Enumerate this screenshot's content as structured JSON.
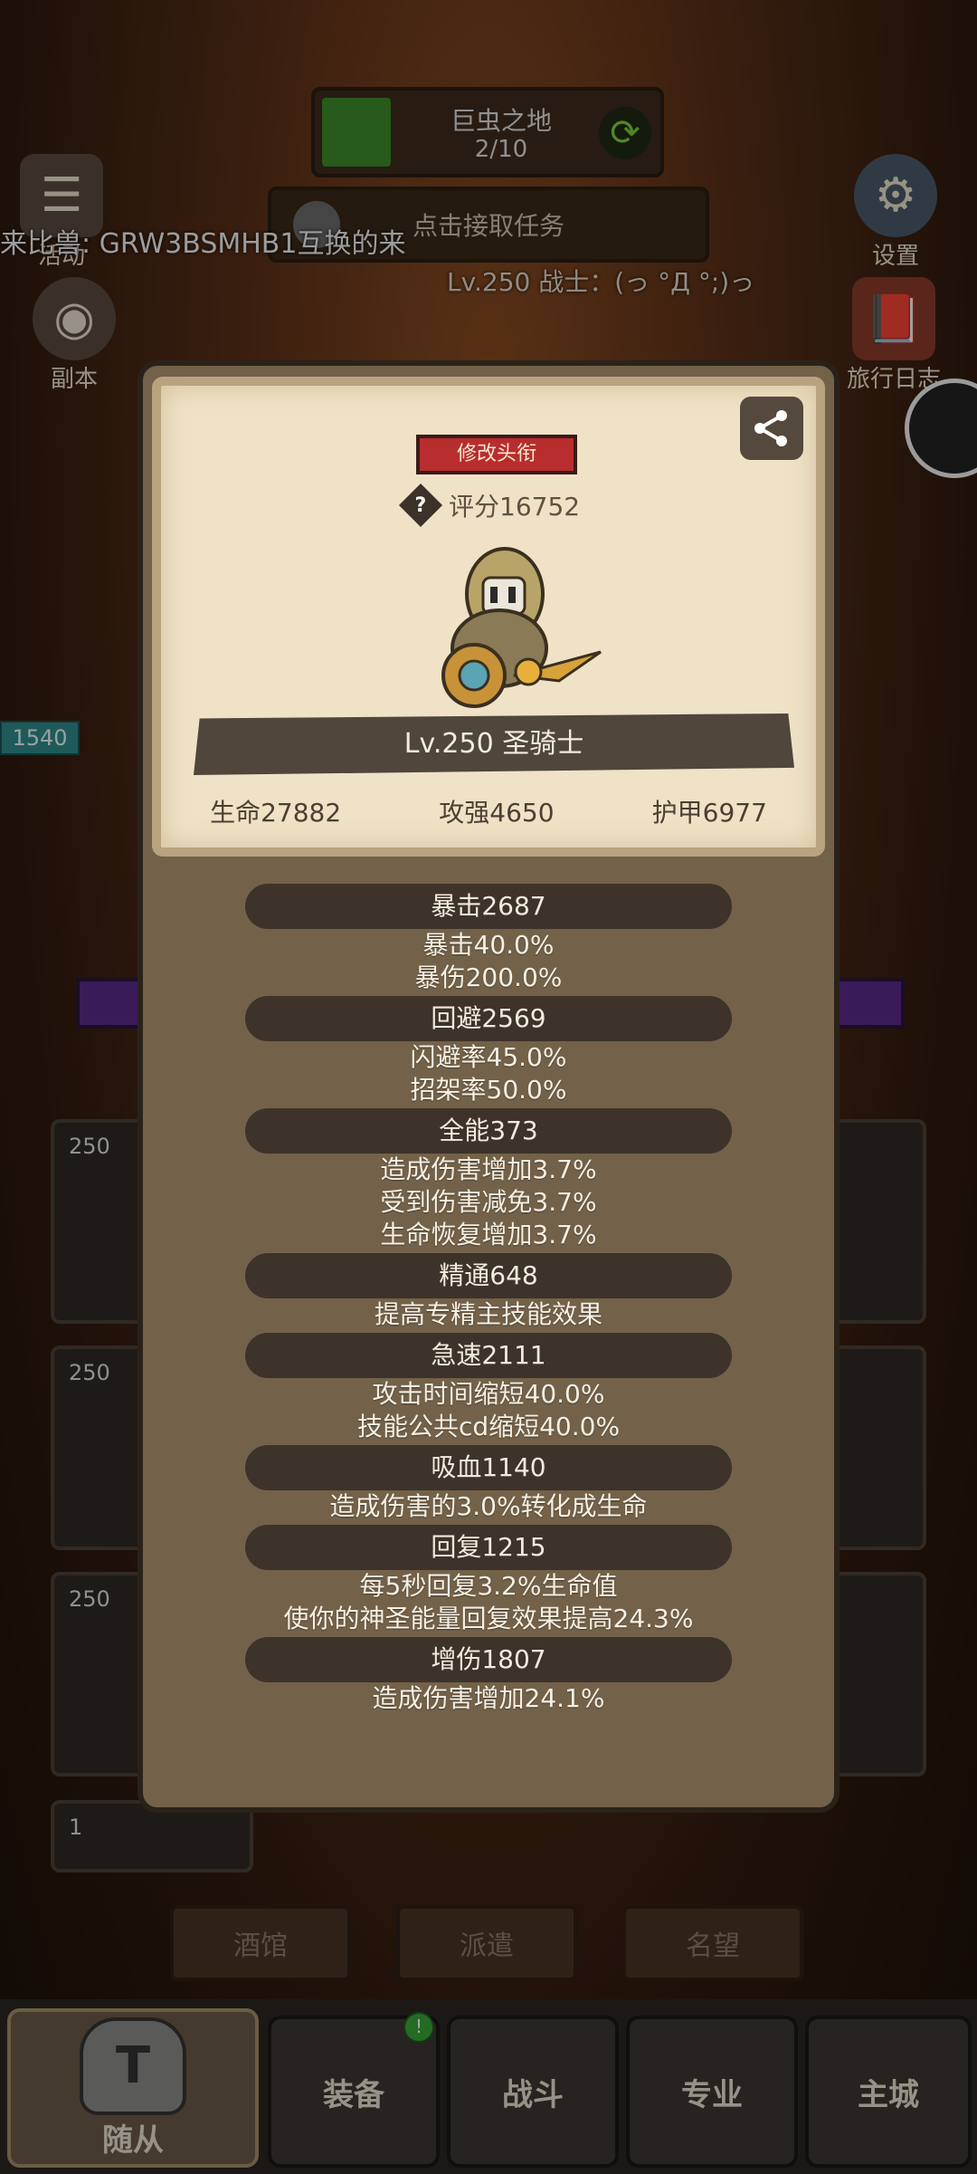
{
  "hud": {
    "region_name": "巨虫之地",
    "region_progress": "2/10",
    "quest_label": "点击接取任务",
    "marquee": "来比兽: GRW3BSMHB1互换的来",
    "level_line": "Lv.250 战士：(っ °Д °;)っ",
    "hp_tag": "1540",
    "left_icons": [
      {
        "label": "活动",
        "icon": "event-icon"
      },
      {
        "label": "副本",
        "icon": "dungeon-icon"
      }
    ],
    "right_icons": [
      {
        "label": "设置",
        "icon": "gear-icon"
      },
      {
        "label": "旅行日志",
        "icon": "journal-icon"
      }
    ]
  },
  "panel": {
    "title_button": "修改头衔",
    "score": "评分16752",
    "hero_name": "Lv.250 圣骑士",
    "base_stats": [
      "生命27882",
      "攻强4650",
      "护甲6977"
    ],
    "stat_groups": [
      {
        "head": "暴击2687",
        "lines": [
          "暴击40.0%",
          "暴伤200.0%"
        ]
      },
      {
        "head": "回避2569",
        "lines": [
          "闪避率45.0%",
          "招架率50.0%"
        ]
      },
      {
        "head": "全能373",
        "lines": [
          "造成伤害增加3.7%",
          "受到伤害减免3.7%",
          "生命恢复增加3.7%"
        ]
      },
      {
        "head": "精通648",
        "lines": [
          "提高专精主技能效果"
        ]
      },
      {
        "head": "急速2111",
        "lines": [
          "攻击时间缩短40.0%",
          "技能公共cd缩短40.0%"
        ]
      },
      {
        "head": "吸血1140",
        "lines": [
          "造成伤害的3.0%转化成生命"
        ]
      },
      {
        "head": "回复1215",
        "lines": [
          "每5秒回复3.2%生命值",
          "使你的神圣能量回复效果提高24.3%"
        ]
      },
      {
        "head": "增伤1807",
        "lines": [
          "造成伤害增加24.1%"
        ]
      }
    ]
  },
  "background": {
    "card_levels": [
      "250",
      "250",
      "250",
      "1"
    ],
    "signs": [
      "酒馆",
      "派遣",
      "名望"
    ]
  },
  "nav": {
    "tabs": [
      "随从",
      "装备",
      "战斗",
      "专业",
      "主城"
    ],
    "badge": "!"
  },
  "colors": {
    "panel_bg": "#736149",
    "parchment": "#efe2c6",
    "title_button": "#b82d2d",
    "stat_head": "#3d332a"
  }
}
